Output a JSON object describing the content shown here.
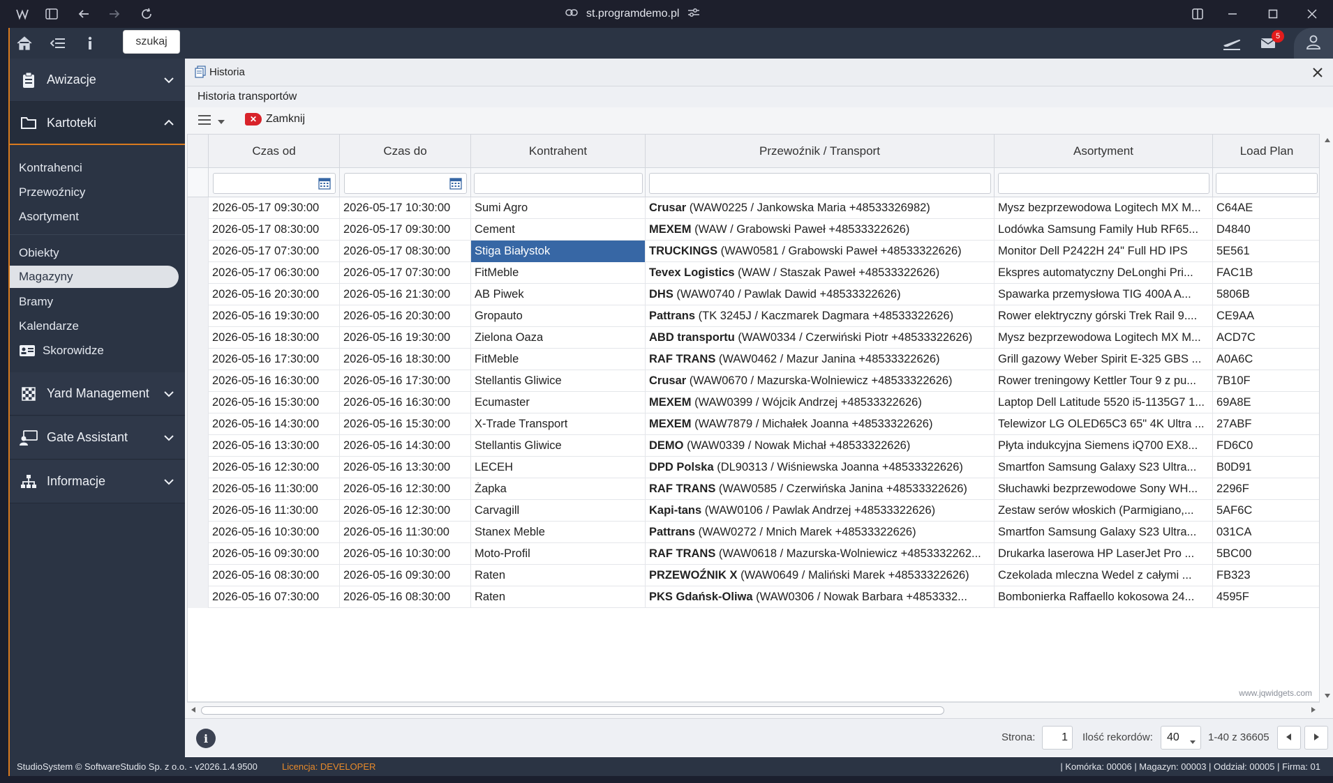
{
  "browser": {
    "url": "st.programdemo.pl"
  },
  "topbar": {
    "search_label": "szukaj",
    "mail_count": "5"
  },
  "sidebar": {
    "groups": [
      {
        "label": "Awizacje",
        "icon": "clipboard-icon"
      },
      {
        "label": "Kartoteki",
        "icon": "folder-icon"
      },
      {
        "label": "Yard Management",
        "icon": "checkered-flag-icon"
      },
      {
        "label": "Gate Assistant",
        "icon": "gate-assistant-icon"
      },
      {
        "label": "Informacje",
        "icon": "sitemap-icon"
      }
    ],
    "sub_items": [
      {
        "label": "Kontrahenci"
      },
      {
        "label": "Przewoźnicy"
      },
      {
        "label": "Asortyment"
      },
      {
        "label": "Obiekty"
      },
      {
        "label": "Magazyny"
      },
      {
        "label": "Bramy"
      },
      {
        "label": "Kalendarze"
      },
      {
        "label": "Skorowidze"
      }
    ]
  },
  "window": {
    "title": "Historia",
    "subtitle": "Historia transportów",
    "close_label": "Zamknij"
  },
  "grid": {
    "columns": [
      "Czas od",
      "Czas do",
      "Kontrahent",
      "Przewoźnik / Transport",
      "Asortyment",
      "Load Plan"
    ],
    "rows": [
      {
        "od": "2026-05-17 09:30:00",
        "do": "2026-05-17 10:30:00",
        "kontrahent": "Sumi Agro",
        "przewoznik": "Crusar",
        "transport": " (WAW0225 / Jankowska Maria +48533326982)",
        "asortyment": "Mysz bezprzewodowa Logitech MX M...",
        "load": "C64AE"
      },
      {
        "od": "2026-05-17 08:30:00",
        "do": "2026-05-17 09:30:00",
        "kontrahent": "Cement",
        "przewoznik": "MEXEM",
        "transport": " (WAW / Grabowski Paweł +48533322626)",
        "asortyment": "Lodówka Samsung Family Hub RF65...",
        "load": "D4840"
      },
      {
        "od": "2026-05-17 07:30:00",
        "do": "2026-05-17 08:30:00",
        "kontrahent": "Stiga Białystok",
        "przewoznik": "TRUCKINGS",
        "transport": " (WAW0581 / Grabowski Paweł +48533322626)",
        "asortyment": "Monitor Dell P2422H 24\" Full HD IPS",
        "load": "5E561"
      },
      {
        "od": "2026-05-17 06:30:00",
        "do": "2026-05-17 07:30:00",
        "kontrahent": "FitMeble",
        "przewoznik": "Tevex Logistics",
        "transport": " (WAW / Staszak Paweł +48533322626)",
        "asortyment": "Ekspres automatyczny DeLonghi Pri...",
        "load": "FAC1B"
      },
      {
        "od": "2026-05-16 20:30:00",
        "do": "2026-05-16 21:30:00",
        "kontrahent": "AB Piwek",
        "przewoznik": "DHS",
        "transport": " (WAW0740 / Pawlak Dawid +48533322626)",
        "asortyment": "Spawarka przemysłowa TIG 400A A...",
        "load": "5806B"
      },
      {
        "od": "2026-05-16 19:30:00",
        "do": "2026-05-16 20:30:00",
        "kontrahent": "Gropauto",
        "przewoznik": "Pattrans",
        "transport": " (TK 3245J / Kaczmarek Dagmara +48533322626)",
        "asortyment": "Rower elektryczny górski Trek Rail 9....",
        "load": "CE9AA"
      },
      {
        "od": "2026-05-16 18:30:00",
        "do": "2026-05-16 19:30:00",
        "kontrahent": "Zielona Oaza",
        "przewoznik": "ABD transportu",
        "transport": " (WAW0334 / Czerwiński Piotr +48533322626)",
        "asortyment": "Mysz bezprzewodowa Logitech MX M...",
        "load": "ACD7C"
      },
      {
        "od": "2026-05-16 17:30:00",
        "do": "2026-05-16 18:30:00",
        "kontrahent": "FitMeble",
        "przewoznik": "RAF TRANS",
        "transport": " (WAW0462 / Mazur Janina +48533322626)",
        "asortyment": "Grill gazowy Weber Spirit E-325 GBS ...",
        "load": "A0A6C"
      },
      {
        "od": "2026-05-16 16:30:00",
        "do": "2026-05-16 17:30:00",
        "kontrahent": "Stellantis Gliwice",
        "przewoznik": "Crusar",
        "transport": " (WAW0670 / Mazurska-Wolniewicz +48533322626)",
        "asortyment": "Rower treningowy Kettler Tour 9 z pu...",
        "load": "7B10F"
      },
      {
        "od": "2026-05-16 15:30:00",
        "do": "2026-05-16 16:30:00",
        "kontrahent": "Ecumaster",
        "przewoznik": "MEXEM",
        "transport": " (WAW0399 / Wójcik Andrzej +48533322626)",
        "asortyment": "Laptop Dell Latitude 5520 i5-1135G7 1...",
        "load": "69A8E"
      },
      {
        "od": "2026-05-16 14:30:00",
        "do": "2026-05-16 15:30:00",
        "kontrahent": "X-Trade Transport",
        "przewoznik": "MEXEM",
        "transport": " (WAW7879 / Michałek Joanna +48533322626)",
        "asortyment": "Telewizor LG OLED65C3 65\" 4K Ultra ...",
        "load": "27ABF"
      },
      {
        "od": "2026-05-16 13:30:00",
        "do": "2026-05-16 14:30:00",
        "kontrahent": "Stellantis Gliwice",
        "przewoznik": "DEMO",
        "transport": " (WAW0339 / Nowak Michał +48533322626)",
        "asortyment": "Płyta indukcyjna Siemens iQ700 EX8...",
        "load": "FD6C0"
      },
      {
        "od": "2026-05-16 12:30:00",
        "do": "2026-05-16 13:30:00",
        "kontrahent": "LECEH",
        "przewoznik": "DPD Polska",
        "transport": " (DL90313 / Wiśniewska Joanna +48533322626)",
        "asortyment": "Smartfon Samsung Galaxy S23 Ultra...",
        "load": "B0D91"
      },
      {
        "od": "2026-05-16 11:30:00",
        "do": "2026-05-16 12:30:00",
        "kontrahent": "Żapka",
        "przewoznik": "RAF TRANS",
        "transport": " (WAW0585 / Czerwińska Janina +48533322626)",
        "asortyment": "Słuchawki bezprzewodowe Sony WH...",
        "load": "2296F"
      },
      {
        "od": "2026-05-16 11:30:00",
        "do": "2026-05-16 12:30:00",
        "kontrahent": "Carvagill",
        "przewoznik": "Kapi-tans",
        "transport": " (WAW0106 / Pawlak Andrzej +48533322626)",
        "asortyment": "Zestaw serów włoskich (Parmigiano,...",
        "load": "5AF6C"
      },
      {
        "od": "2026-05-16 10:30:00",
        "do": "2026-05-16 11:30:00",
        "kontrahent": "Stanex Meble",
        "przewoznik": "Pattrans",
        "transport": " (WAW0272 / Mnich Marek +48533322626)",
        "asortyment": "Smartfon Samsung Galaxy S23 Ultra...",
        "load": "031CA"
      },
      {
        "od": "2026-05-16 09:30:00",
        "do": "2026-05-16 10:30:00",
        "kontrahent": "Moto-Profil",
        "przewoznik": "RAF TRANS",
        "transport": " (WAW0618 / Mazurska-Wolniewicz +4853332262...",
        "asortyment": "Drukarka laserowa HP LaserJet Pro ...",
        "load": "5BC00"
      },
      {
        "od": "2026-05-16 08:30:00",
        "do": "2026-05-16 09:30:00",
        "kontrahent": "Raten",
        "przewoznik": "PRZEWOŹNIK X",
        "transport": " (WAW0649 / Maliński Marek +48533322626)",
        "asortyment": "Czekolada mleczna Wedel z całymi ...",
        "load": "FB323"
      },
      {
        "od": "2026-05-16 07:30:00",
        "do": "2026-05-16 08:30:00",
        "kontrahent": "Raten",
        "przewoznik": "PKS Gdańsk-Oliwa",
        "transport": " (WAW0306 / Nowak Barbara +4853332...",
        "asortyment": "Bombonierka Raffaello kokosowa 24...",
        "load": "4595F"
      }
    ]
  },
  "watermark": "www.jqwidgets.com",
  "pager": {
    "page_label": "Strona:",
    "page_value": "1",
    "records_label": "Ilość rekordów:",
    "records_value": "40",
    "range": "1-40 z 36605"
  },
  "status": {
    "copyright": "StudioSystem © SoftwareStudio Sp. z o.o. - v2026.1.4.9500",
    "license": "Licencja: DEVELOPER",
    "right": "| Komórka: 00006 | Magazyn: 00003 | Oddział: 00005 | Firma: 01"
  },
  "colors": {
    "accent": "#d97a1e",
    "selection": "#3767a5",
    "sidebar": "#2b3444",
    "badge": "#e21c1c"
  }
}
